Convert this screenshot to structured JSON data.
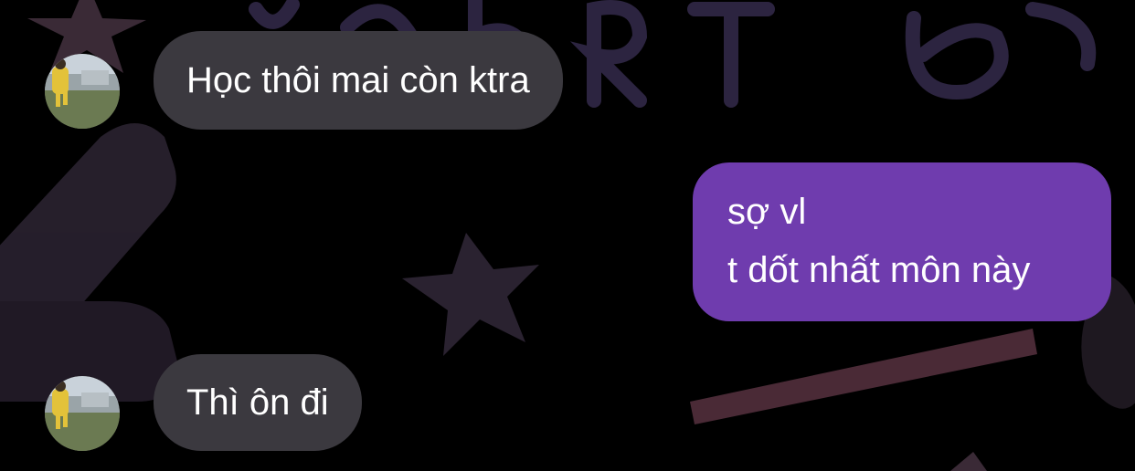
{
  "colors": {
    "background": "#000000",
    "incoming_bubble": "#3b393f",
    "outgoing_bubble": "#6f3cae",
    "text": "#ffffff",
    "wallpaper_art": "#2a2230"
  },
  "conversation": {
    "messages": [
      {
        "direction": "incoming",
        "avatar_icon": "profile-photo-soccer-field",
        "text": "Học thôi mai còn ktra"
      },
      {
        "direction": "outgoing",
        "lines": [
          "sợ vl",
          "t dốt nhất môn này"
        ]
      },
      {
        "direction": "incoming",
        "avatar_icon": "profile-photo-soccer-field",
        "text": "Thì ôn đi"
      }
    ]
  }
}
